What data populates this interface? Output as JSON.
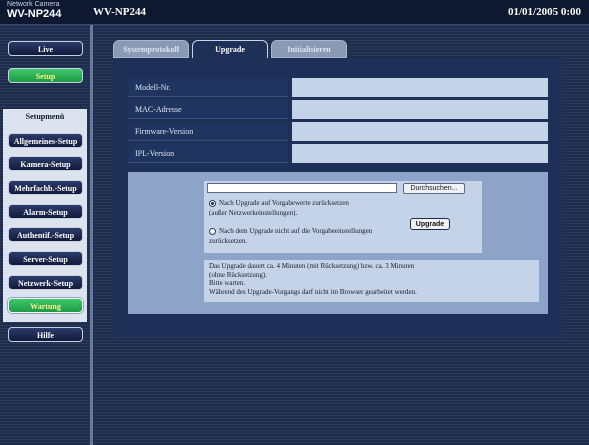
{
  "header": {
    "brand_small": "Network Camera",
    "brand_model": "WV-NP244",
    "camera_title": "WV-NP244",
    "datetime": "01/01/2005  0:00"
  },
  "sidebar": {
    "live": "Live",
    "setup": "Setup",
    "menu_title": "Setupmenü",
    "items": [
      "Allgemeines-Setup",
      "Kamera-Setup",
      "Mehrfachb.-Setup",
      "Alarm-Setup",
      "Authentif.-Setup",
      "Server-Setup",
      "Netzwerk-Setup",
      "Wartung"
    ],
    "help": "Hilfe"
  },
  "tabs": [
    "Systemprotokoll",
    "Upgrade",
    "Initialisieren"
  ],
  "info": {
    "rows": [
      "Modell-Nr.",
      "MAC-Adresse",
      "Firmware-Version",
      "IPL-Version"
    ]
  },
  "upgrade": {
    "file_value": "",
    "browse_label": "Durchsuchen...",
    "radio1_line1": "Nach Upgrade auf Vorgabewerte zurücksetzen",
    "radio1_line2": "(außer Netzwerkeinstellungen).",
    "radio2_line1": "Nach dem Upgrade nicht auf die Vorgabeeinstellungen",
    "radio2_line2": "zurücksetzen.",
    "upgrade_label": "Upgrade"
  },
  "note": {
    "lines": [
      "Das Upgrade dauert ca. 4 Minuten (mit Rücksetzung) bzw. ca. 3 Minuten",
      "(ohne Rücksetzung).",
      "Bitte warten.",
      "Während des Upgrade-Vorgangs darf nicht im Browser gearbeitet werden."
    ]
  },
  "colors": {
    "header_bg": "#0e1830",
    "panel_bg": "#1e3058",
    "setup_green": "#2bb055",
    "field_bg": "#c5d3e9"
  }
}
